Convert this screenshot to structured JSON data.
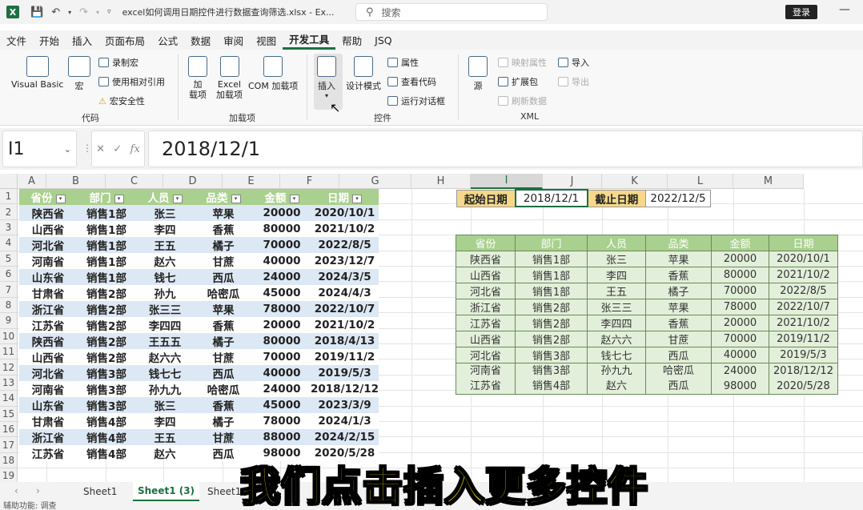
{
  "titlebar": {
    "app_icon": "X",
    "doc_title": "excel如何调用日期控件进行数据查询筛选.xlsx - Ex...",
    "search_placeholder": "搜索",
    "login_label": "登录",
    "minimize_glyph": "—"
  },
  "menu": [
    "文件",
    "开始",
    "插入",
    "页面布局",
    "公式",
    "数据",
    "审阅",
    "视图",
    "开发工具",
    "帮助",
    "JSQ"
  ],
  "menu_active": "开发工具",
  "ribbon": {
    "code": {
      "visual_basic": "Visual Basic",
      "macro": "宏",
      "record_macro": "录制宏",
      "relative_ref": "使用相对引用",
      "macro_security": "宏安全性",
      "group": "代码"
    },
    "addins": {
      "add": "加\n载项",
      "excel_addins": "Excel\n加载项",
      "com_addins": "COM 加载项",
      "group": "加载项"
    },
    "controls": {
      "insert": "插入",
      "design_mode": "设计模式",
      "properties": "属性",
      "view_code": "查看代码",
      "run_dialog": "运行对话框",
      "group": "控件"
    },
    "xml": {
      "source": "源",
      "map_properties": "映射属性",
      "expansion_packs": "扩展包",
      "refresh_data": "刷新数据",
      "import": "导入",
      "export": "导出",
      "group": "XML"
    }
  },
  "formula_bar": {
    "name_box": "I1",
    "formula": "2018/12/1"
  },
  "columns": [
    "A",
    "B",
    "C",
    "D",
    "E",
    "F",
    "G",
    "H",
    "I",
    "J",
    "K",
    "L",
    "M"
  ],
  "selected_column": "I",
  "rows": [
    "1",
    "2",
    "3",
    "4",
    "5",
    "6",
    "7",
    "8",
    "9",
    "10",
    "11",
    "12",
    "13",
    "14",
    "15",
    "16",
    "17",
    "18",
    "19"
  ],
  "main_table": {
    "headers": [
      "省份",
      "部门",
      "人员",
      "品类",
      "金额",
      "日期"
    ],
    "rows": [
      [
        "陕西省",
        "销售1部",
        "张三",
        "苹果",
        "20000",
        "2020/10/1"
      ],
      [
        "山西省",
        "销售1部",
        "李四",
        "香蕉",
        "80000",
        "2021/10/2"
      ],
      [
        "河北省",
        "销售1部",
        "王五",
        "橘子",
        "70000",
        "2022/8/5"
      ],
      [
        "河南省",
        "销售1部",
        "赵六",
        "甘蔗",
        "40000",
        "2023/12/7"
      ],
      [
        "山东省",
        "销售1部",
        "钱七",
        "西瓜",
        "24000",
        "2024/3/5"
      ],
      [
        "甘肃省",
        "销售2部",
        "孙九",
        "哈密瓜",
        "45000",
        "2024/4/3"
      ],
      [
        "浙江省",
        "销售2部",
        "张三三",
        "苹果",
        "78000",
        "2022/10/7"
      ],
      [
        "江苏省",
        "销售2部",
        "李四四",
        "香蕉",
        "20000",
        "2021/10/2"
      ],
      [
        "陕西省",
        "销售2部",
        "王五五",
        "橘子",
        "80000",
        "2018/4/13"
      ],
      [
        "山西省",
        "销售2部",
        "赵六六",
        "甘蔗",
        "70000",
        "2019/11/2"
      ],
      [
        "河北省",
        "销售3部",
        "钱七七",
        "西瓜",
        "40000",
        "2019/5/3"
      ],
      [
        "河南省",
        "销售3部",
        "孙九九",
        "哈密瓜",
        "24000",
        "2018/12/12"
      ],
      [
        "山东省",
        "销售3部",
        "张三",
        "香蕉",
        "45000",
        "2023/3/9"
      ],
      [
        "甘肃省",
        "销售4部",
        "李四",
        "橘子",
        "78000",
        "2024/1/3"
      ],
      [
        "浙江省",
        "销售4部",
        "王五",
        "甘蔗",
        "88000",
        "2024/2/15"
      ],
      [
        "江苏省",
        "销售4部",
        "赵六",
        "西瓜",
        "98000",
        "2020/5/28"
      ]
    ]
  },
  "criteria": {
    "start_label": "起始日期",
    "start_value": "2018/12/1",
    "end_label": "截止日期",
    "end_value": "2022/12/5"
  },
  "result_table": {
    "headers": [
      "省份",
      "部门",
      "人员",
      "品类",
      "金额",
      "日期"
    ],
    "rows": [
      [
        "陕西省",
        "销售1部",
        "张三",
        "苹果",
        "20000",
        "2020/10/1"
      ],
      [
        "山西省",
        "销售1部",
        "李四",
        "香蕉",
        "80000",
        "2021/10/2"
      ],
      [
        "河北省",
        "销售1部",
        "王五",
        "橘子",
        "70000",
        "2022/8/5"
      ],
      [
        "浙江省",
        "销售2部",
        "张三三",
        "苹果",
        "78000",
        "2022/10/7"
      ],
      [
        "江苏省",
        "销售2部",
        "李四四",
        "香蕉",
        "20000",
        "2021/10/2"
      ],
      [
        "山西省",
        "销售2部",
        "赵六六",
        "甘蔗",
        "70000",
        "2019/11/2"
      ],
      [
        "河北省",
        "销售3部",
        "钱七七",
        "西瓜",
        "40000",
        "2019/5/3"
      ]
    ],
    "merged_rows": [
      [
        "河南省\n江苏省",
        "销售3部\n销售4部",
        "孙九九\n赵六",
        "哈密瓜\n西瓜",
        "24000\n98000",
        "2018/12/12\n2020/5/28"
      ]
    ]
  },
  "sheet_tabs": [
    "Sheet1",
    "Sheet1 (3)",
    "Sheet1"
  ],
  "active_sheet": "Sheet1 (3)",
  "status": "辅助功能: 调查",
  "caption": "我们点击插入更多控件",
  "colors": {
    "accent": "#1d6f42",
    "header_green": "#a9d08e",
    "band_blue": "#dde8f5",
    "criteria_yellow": "#f5d88a",
    "caption_yellow": "#ffe600"
  }
}
